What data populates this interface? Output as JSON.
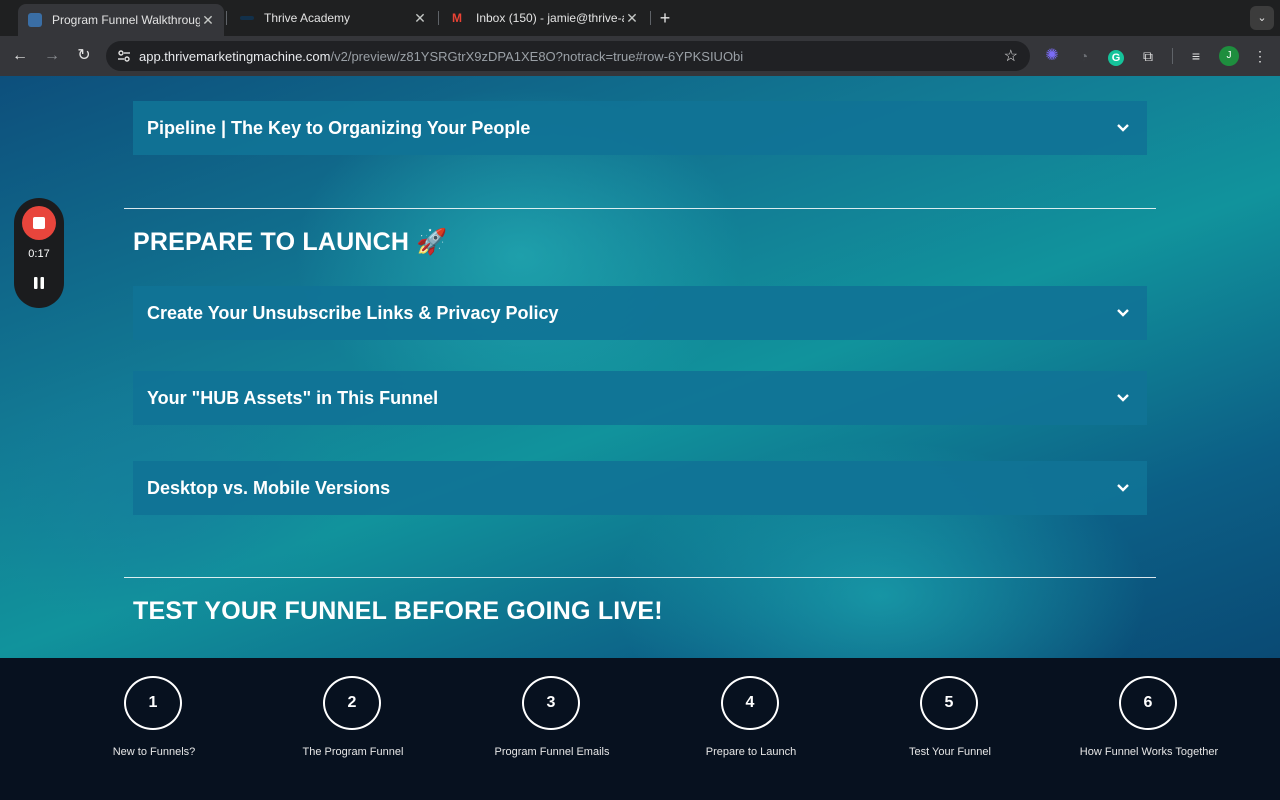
{
  "browser": {
    "tabs": [
      {
        "title": "Program Funnel Walkthrough",
        "active": true
      },
      {
        "title": "Thrive Academy",
        "active": false
      },
      {
        "title": "Inbox (150) - jamie@thrive-ac",
        "active": false
      }
    ],
    "new_tab": "+",
    "url_host": "app.thrivemarketingmachine.com",
    "url_path": "/v2/preview/z81YSRGtrX9zDPA1XE8O?notrack=true#row-6YPKSIUObi",
    "profile_initial": "J"
  },
  "recorder": {
    "time": "0:17"
  },
  "page": {
    "top_accordion": "Pipeline | The Key to Organizing Your People",
    "section_prepare": {
      "heading": "PREPARE TO LAUNCH 🚀",
      "items": [
        "Create Your Unsubscribe Links & Privacy Policy",
        "Your \"HUB Assets\" in This Funnel",
        "Desktop vs. Mobile Versions"
      ]
    },
    "section_test": {
      "heading": "TEST YOUR FUNNEL BEFORE GOING LIVE!"
    }
  },
  "steps": [
    {
      "number": "1",
      "label": "New to Funnels?"
    },
    {
      "number": "2",
      "label": "The Program Funnel"
    },
    {
      "number": "3",
      "label": "Program Funnel Emails"
    },
    {
      "number": "4",
      "label": "Prepare to Launch"
    },
    {
      "number": "5",
      "label": "Test Your Funnel"
    },
    {
      "number": "6",
      "label": "How Funnel Works Together"
    }
  ]
}
